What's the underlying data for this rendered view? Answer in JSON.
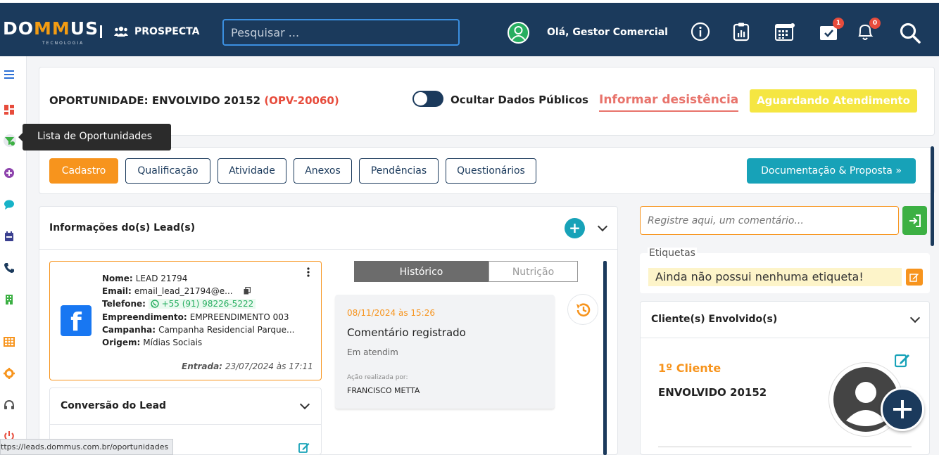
{
  "brand": {
    "name_prefix": "DO",
    "name_highlight": "MM",
    "name_suffix": "US",
    "tagline": "TECNOLOGIA",
    "accent": "#f7941d",
    "primary": "#1b3a5c"
  },
  "header": {
    "module": "PROSPECTA",
    "search_placeholder": "Pesquisar ...",
    "greeting": "Olá, Gestor Comercial",
    "icons": [
      "info-icon",
      "clipboard-chart-icon",
      "calendar-icon",
      "task-check-icon",
      "bell-icon",
      "search-icon"
    ],
    "task_badge": "1",
    "bell_badge": "0"
  },
  "sidebar": {
    "tooltip": "Lista de Oportunidades",
    "icons": [
      "menu-icon",
      "dashboard-icon",
      "funnel-icon",
      "plus-circle-icon",
      "chat-icon",
      "calendar-icon",
      "phone-icon",
      "building-icon",
      "grid-icon",
      "gear-icon",
      "headset-icon",
      "power-icon"
    ]
  },
  "opportunity": {
    "title": "OPORTUNIDADE: ENVOLVIDO 20152",
    "code": "(OPV-20060)",
    "toggle_label": "Ocultar Dados Públicos",
    "desist_label": "Informar desistência",
    "status": "Aguardando Atendimento"
  },
  "tabs": [
    "Cadastro",
    "Qualificação",
    "Atividade",
    "Anexos",
    "Pendências",
    "Questionários"
  ],
  "doc_button": "Documentação & Proposta »",
  "lead_section": {
    "title": "Informações do(s) Lead(s)",
    "lead": {
      "name_label": "Nome:",
      "name": "LEAD 21794",
      "email_label": "Email:",
      "email": "email_lead_21794@e...",
      "phone_label": "Telefone:",
      "phone": "+55 (91) 98226-5222",
      "enterprise_label": "Empreendimento:",
      "enterprise": "EMPREENDIMENTO 003",
      "campaign_label": "Campanha:",
      "campaign": "Campanha Residencial Parque...",
      "origin_label": "Origem:",
      "origin": "Mídias Sociais",
      "entry_label": "Entrada:",
      "entry": "23/07/2024 às 17:11"
    },
    "conversion_title": "Conversão do Lead"
  },
  "history": {
    "tab_active": "Histórico",
    "tab_inactive": "Nutrição",
    "entry": {
      "date": "08/11/2024 às 15:26",
      "title": "Comentário registrado",
      "status": "Em atendim",
      "action_label": "Ação realizada por:",
      "actor": "FRANCISCO METTA"
    }
  },
  "right": {
    "comment_placeholder": "Registre aqui, um comentário...",
    "tags_label": "Etiquetas",
    "no_tags": "Ainda não possui nenhuma etiqueta!",
    "clients_title": "Cliente(s) Envolvido(s)",
    "client_label": "1º Cliente",
    "client_name": "ENVOLVIDO 20152"
  },
  "status_url": "ttps://leads.dommus.com.br/oportunidades"
}
